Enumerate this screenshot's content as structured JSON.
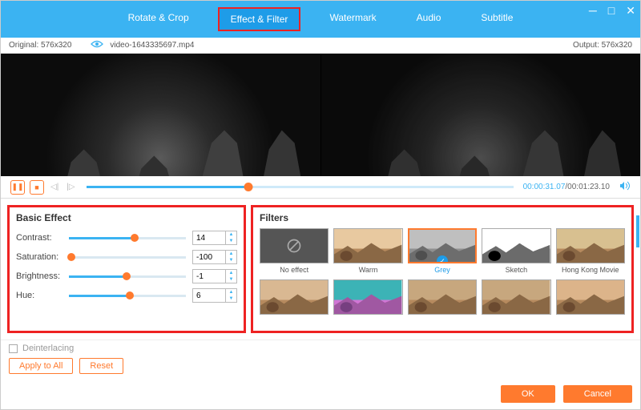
{
  "window": {
    "minimize_icon": "minimize",
    "maximize_icon": "maximize",
    "close_icon": "close"
  },
  "tabs": {
    "rotate": "Rotate & Crop",
    "effect": "Effect & Filter",
    "watermark": "Watermark",
    "audio": "Audio",
    "subtitle": "Subtitle",
    "active": "effect"
  },
  "info": {
    "original_label": "Original: 576x320",
    "filename": "video-1643335697.mp4",
    "output_label": "Output: 576x320"
  },
  "transport": {
    "current_time": "00:00:31.07",
    "total_time": "/00:01:23.10",
    "progress_pct": 38
  },
  "basic_effect": {
    "title": "Basic Effect",
    "rows": [
      {
        "label": "Contrast:",
        "value": "14",
        "fill_pct": 56,
        "knob_pct": 56
      },
      {
        "label": "Saturation:",
        "value": "-100",
        "fill_pct": 2,
        "knob_pct": 2
      },
      {
        "label": "Brightness:",
        "value": "-1",
        "fill_pct": 49,
        "knob_pct": 49
      },
      {
        "label": "Hue:",
        "value": "6",
        "fill_pct": 52,
        "knob_pct": 52
      }
    ]
  },
  "filters": {
    "title": "Filters",
    "items": [
      {
        "name": "No effect",
        "kind": "none"
      },
      {
        "name": "Warm",
        "kind": "warm"
      },
      {
        "name": "Grey",
        "kind": "grey",
        "selected": true
      },
      {
        "name": "Sketch",
        "kind": "sketch"
      },
      {
        "name": "Hong Kong Movie",
        "kind": "hk"
      },
      {
        "name": "",
        "kind": "f6"
      },
      {
        "name": "",
        "kind": "f7"
      },
      {
        "name": "",
        "kind": "f8"
      },
      {
        "name": "",
        "kind": "f9"
      },
      {
        "name": "",
        "kind": "f10"
      }
    ]
  },
  "bottom": {
    "deinterlacing": "Deinterlacing",
    "apply_all": "Apply to All",
    "reset": "Reset",
    "ok": "OK",
    "cancel": "Cancel"
  }
}
